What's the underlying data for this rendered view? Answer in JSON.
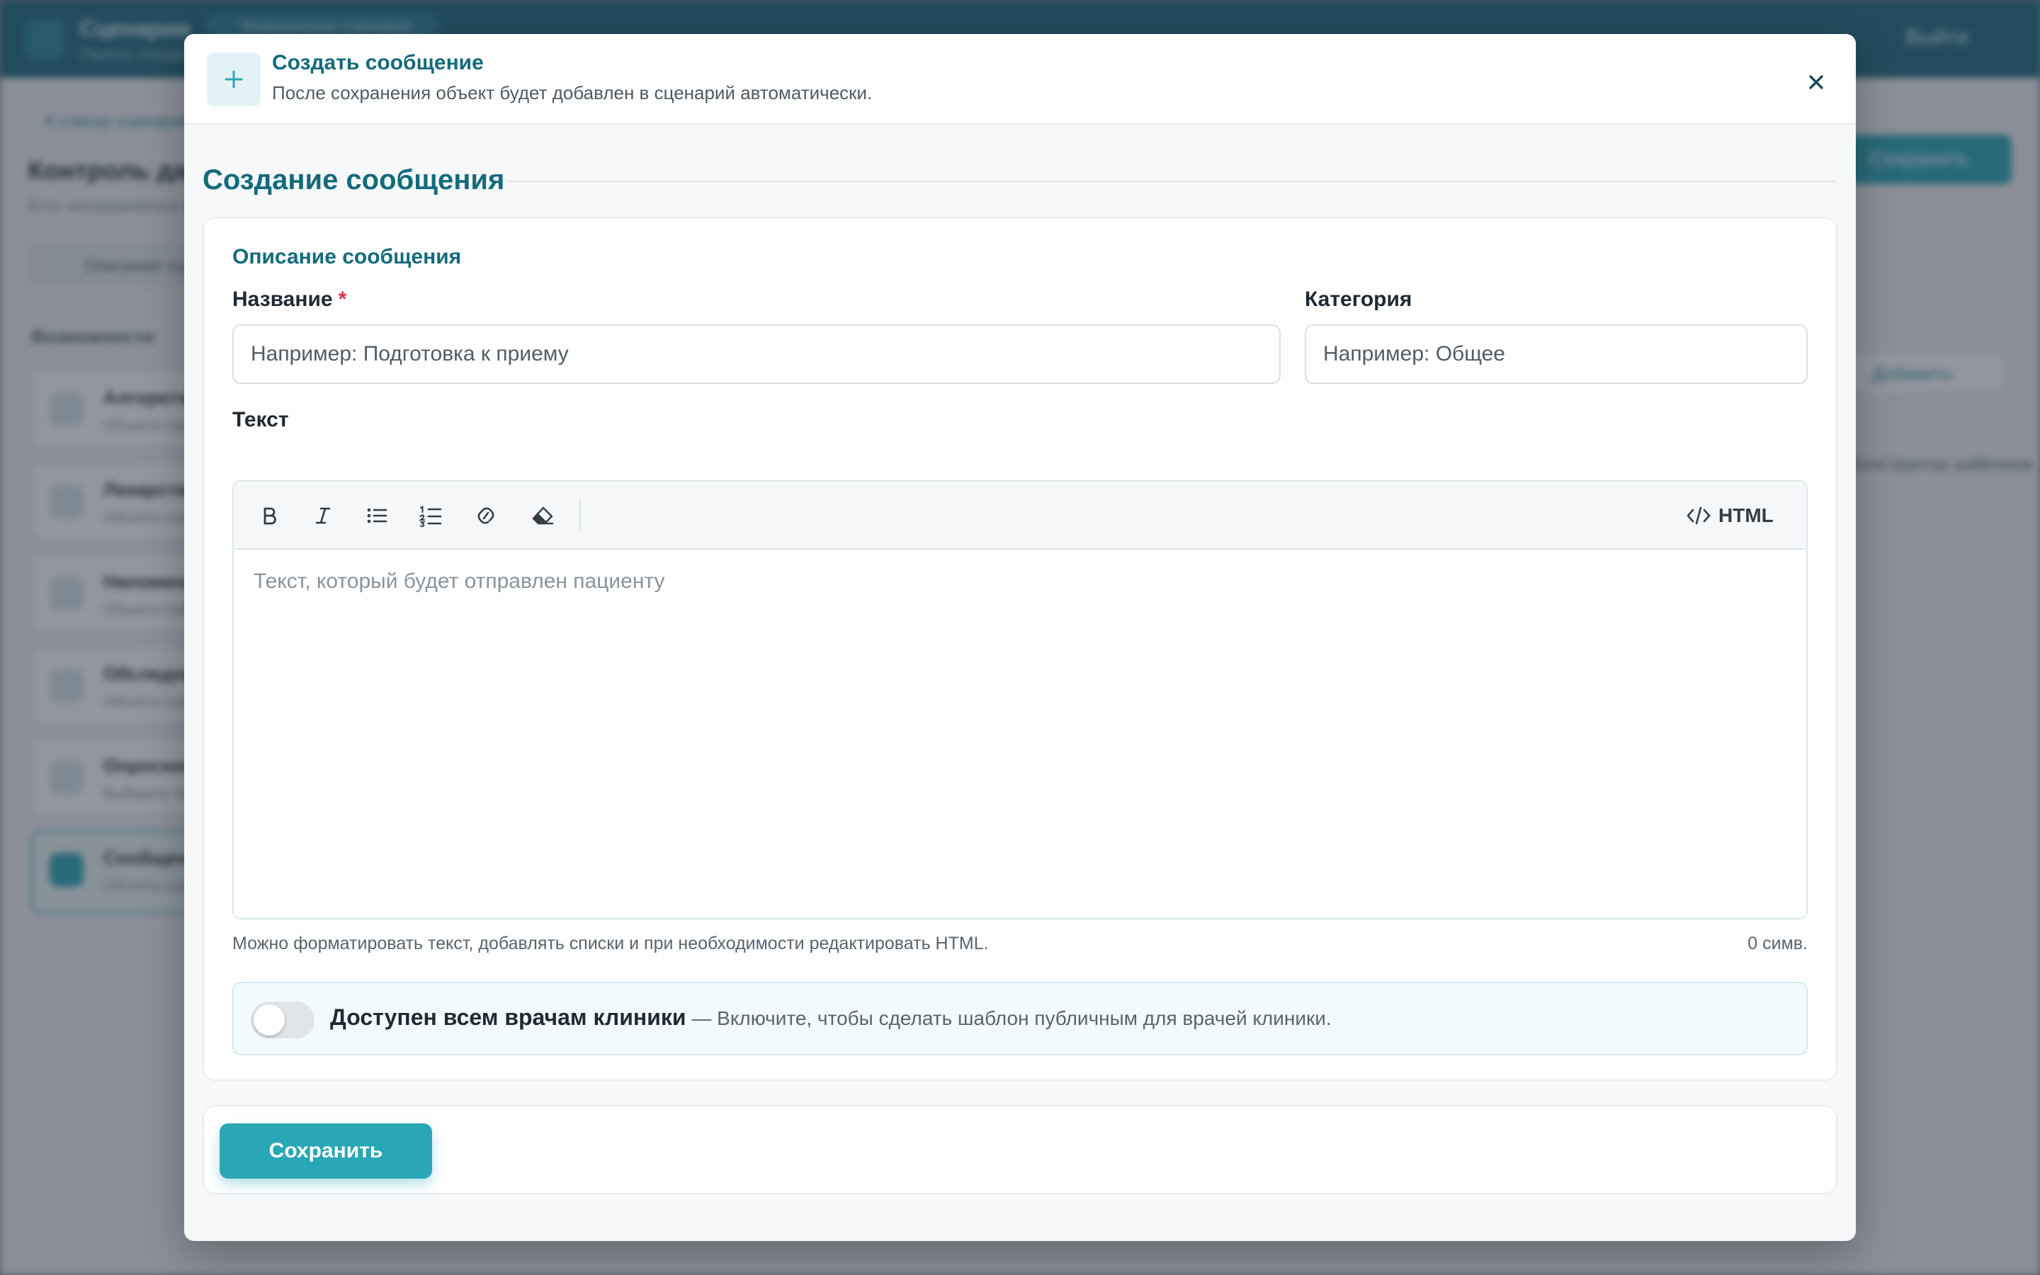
{
  "background": {
    "app_title": "Сценарии",
    "app_subtitle": "Панель специалиста",
    "top_pill": "Медицинские сценарии",
    "logout": "Выйти",
    "back_link": "К списку сценариев",
    "page_title": "Контроль давления",
    "page_subtitle": "Есть несохранённые изменения",
    "tab": "Описание сценария",
    "section": "Возможности",
    "cards": [
      {
        "title": "Алгоритм",
        "sub": "Объекты сценария"
      },
      {
        "title": "Лекарства",
        "sub": "Объекты сценария"
      },
      {
        "title": "Напоминания",
        "sub": "Объекты сценария"
      },
      {
        "title": "Обследования",
        "sub": "Объекты сценария"
      },
      {
        "title": "Опросники",
        "sub": "Выберите опросник"
      },
      {
        "title": "Сообщения",
        "sub": "Объекты сценария"
      }
    ],
    "save": "Сохранить",
    "add": "Добавить",
    "link": "Конструктор шаблонов"
  },
  "modal": {
    "title": "Создать сообщение",
    "subtitle": "После сохранения объект будет добавлен в сценарий автоматически.",
    "section_title": "Создание сообщения",
    "card_subtitle": "Описание сообщения",
    "fields": {
      "name": {
        "label": "Название",
        "required_mark": "*",
        "value": "",
        "placeholder": "Например: Подготовка к приему"
      },
      "category": {
        "label": "Категория",
        "value": "",
        "placeholder": "Например: Общее"
      }
    },
    "text_label": "Текст",
    "editor": {
      "toolbar": [
        "bold",
        "italic",
        "bullet-list",
        "numbered-list",
        "link",
        "clear-format"
      ],
      "html_label": "HTML",
      "placeholder": "Текст, который будет отправлен пациенту"
    },
    "helper_text": "Можно форматировать текст, добавлять списки и при необходимости редактировать HTML.",
    "char_count": "0 симв.",
    "toggle": {
      "label": "Доступен всем врачам клиники",
      "description": " — Включите, чтобы сделать шаблон публичным для врачей клиники.",
      "enabled": false
    },
    "save_label": "Сохранить"
  },
  "colors": {
    "accent": "#2aa7b6",
    "title": "#136b7c",
    "required": "#d9344a"
  }
}
